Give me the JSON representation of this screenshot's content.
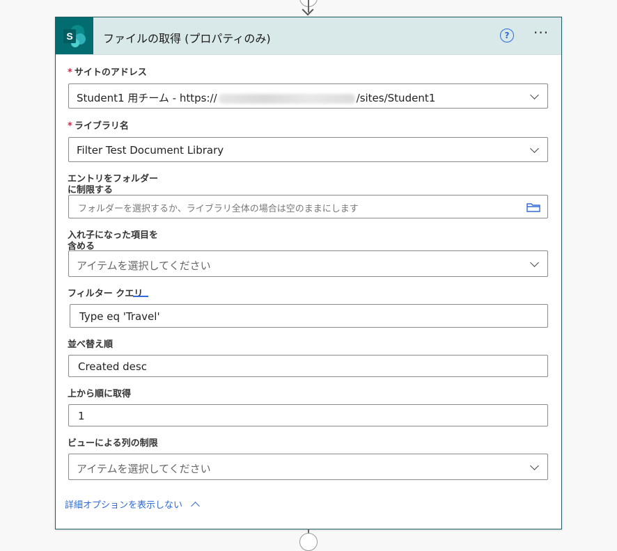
{
  "card": {
    "title": "ファイルの取得 (プロパティのみ)",
    "help_symbol": "?",
    "more_symbol": "···"
  },
  "fields": {
    "site_address": {
      "label": "サイトのアドレス",
      "required": "*",
      "value_prefix": "Student1 用チーム - https://",
      "value_suffix": "/sites/Student1"
    },
    "library_name": {
      "label": "ライブラリ名",
      "required": "*",
      "value": "Filter Test Document Library"
    },
    "folder_limit": {
      "label_line1": "エントリをフォルダー",
      "label_line2": "に制限する",
      "placeholder": "フォルダーを選択するか、ライブラリ全体の場合は空のままにします"
    },
    "include_nested": {
      "label_line1": "入れ子になった項目を",
      "label_line2": "含める",
      "placeholder": "アイテムを選択してください"
    },
    "filter_query": {
      "label": "フィルター クエリ",
      "value": "Type eq 'Travel'"
    },
    "order_by": {
      "label": "並べ替え順",
      "value": "Created desc"
    },
    "top_count": {
      "label": "上から順に取得",
      "value": "1"
    },
    "view_limit": {
      "label": "ビューによる列の制限",
      "placeholder": "アイテムを選択してください"
    }
  },
  "advanced_toggle": "詳細オプションを表示しない",
  "colors": {
    "accent": "#2f6ad6",
    "header_bg": "#d9e8e8",
    "sharepoint": "#036c70",
    "required": "#c4314b"
  }
}
